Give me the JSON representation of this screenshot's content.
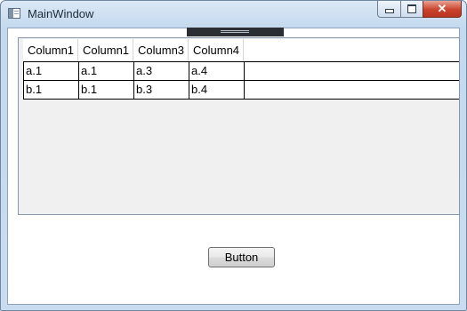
{
  "window": {
    "title": "MainWindow",
    "caption_buttons": {
      "minimize_icon": "minimize-icon",
      "maximize_icon": "maximize-icon",
      "close_glyph": "✕"
    }
  },
  "grid": {
    "columns": [
      "Column1",
      "Column1",
      "Column3",
      "Column4"
    ],
    "rows": [
      [
        "a.1",
        "a.1",
        "a.3",
        "a.4"
      ],
      [
        "b.1",
        "b.1",
        "b.3",
        "b.4"
      ]
    ]
  },
  "main": {
    "button_label": "Button"
  },
  "colors": {
    "close_red": "#c9432c",
    "title_bar": "#c4d9ee",
    "grid_background": "#f0f0f0"
  }
}
